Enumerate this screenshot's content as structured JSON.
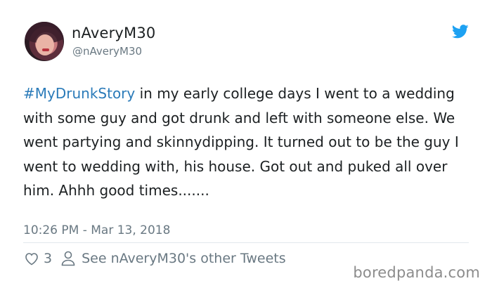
{
  "user": {
    "display_name": "nAveryM30",
    "handle": "@nAveryM30",
    "avatar_icon": "profile-photo"
  },
  "tweet": {
    "hashtag": "#MyDrunkStory",
    "text": " in my early college days I went to a wedding with some guy and got drunk and left with someone else. We went partying and skinnydipping. It turned out to be the guy I went to wedding with, his house. Got out and puked all over him.  Ahhh good times.......",
    "timestamp": "10:26 PM - Mar 13, 2018"
  },
  "actions": {
    "like_count": "3",
    "profile_link": "See nAveryM30's other Tweets"
  },
  "watermark": "boredpanda.com",
  "colors": {
    "hashtag": "#2b7bb9",
    "twitter_blue": "#1da1f2",
    "text": "#1c2022",
    "muted": "#697882"
  }
}
